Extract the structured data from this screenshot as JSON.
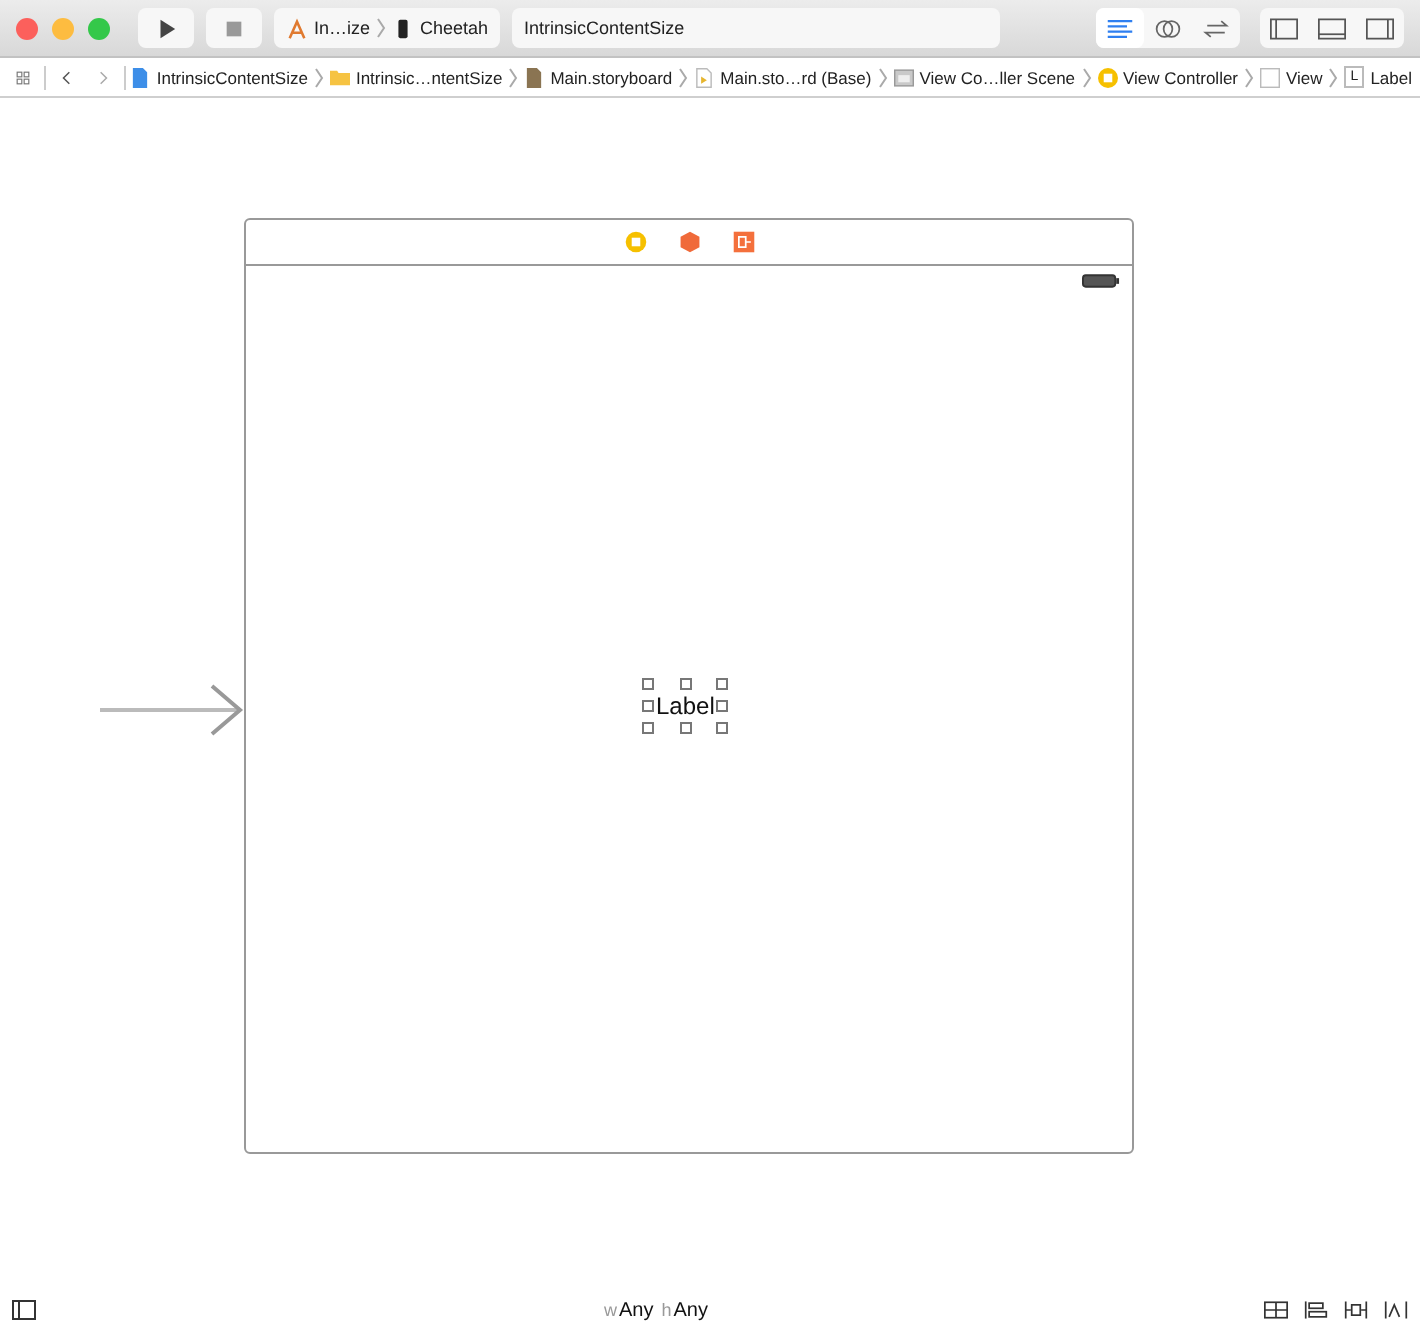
{
  "window": {
    "traffic_lights": [
      {
        "color": "#fc605c"
      },
      {
        "color": "#fdbc40"
      },
      {
        "color": "#34c84a"
      }
    ]
  },
  "toolbar": {
    "scheme": "In…ize",
    "destination": "Cheetah",
    "activity": "IntrinsicContentSize",
    "editor_modes": [
      {
        "kind": "standard",
        "selected": true
      },
      {
        "kind": "assistant",
        "selected": false
      },
      {
        "kind": "version",
        "selected": false
      }
    ],
    "panels": [
      {
        "kind": "navigator",
        "selected": false
      },
      {
        "kind": "debug",
        "selected": false
      },
      {
        "kind": "utilities",
        "selected": false
      }
    ]
  },
  "jump_bar": [
    {
      "kind": "project",
      "label": "IntrinsicContentSize"
    },
    {
      "kind": "folder",
      "label": "Intrinsic…ntentSize"
    },
    {
      "kind": "storyboard",
      "label": "Main.storyboard"
    },
    {
      "kind": "localized",
      "label": "Main.sto…rd (Base)"
    },
    {
      "kind": "scene",
      "label": "View Co…ller Scene"
    },
    {
      "kind": "controller",
      "label": "View Controller"
    },
    {
      "kind": "view",
      "label": "View"
    },
    {
      "kind": "label",
      "icon_text": "L",
      "label": "Label"
    }
  ],
  "scene": {
    "label_text": "Label",
    "label_selected": true
  },
  "size_class": [
    {
      "prefix": "w",
      "value": "Any"
    },
    {
      "prefix": "h",
      "value": "Any"
    }
  ]
}
